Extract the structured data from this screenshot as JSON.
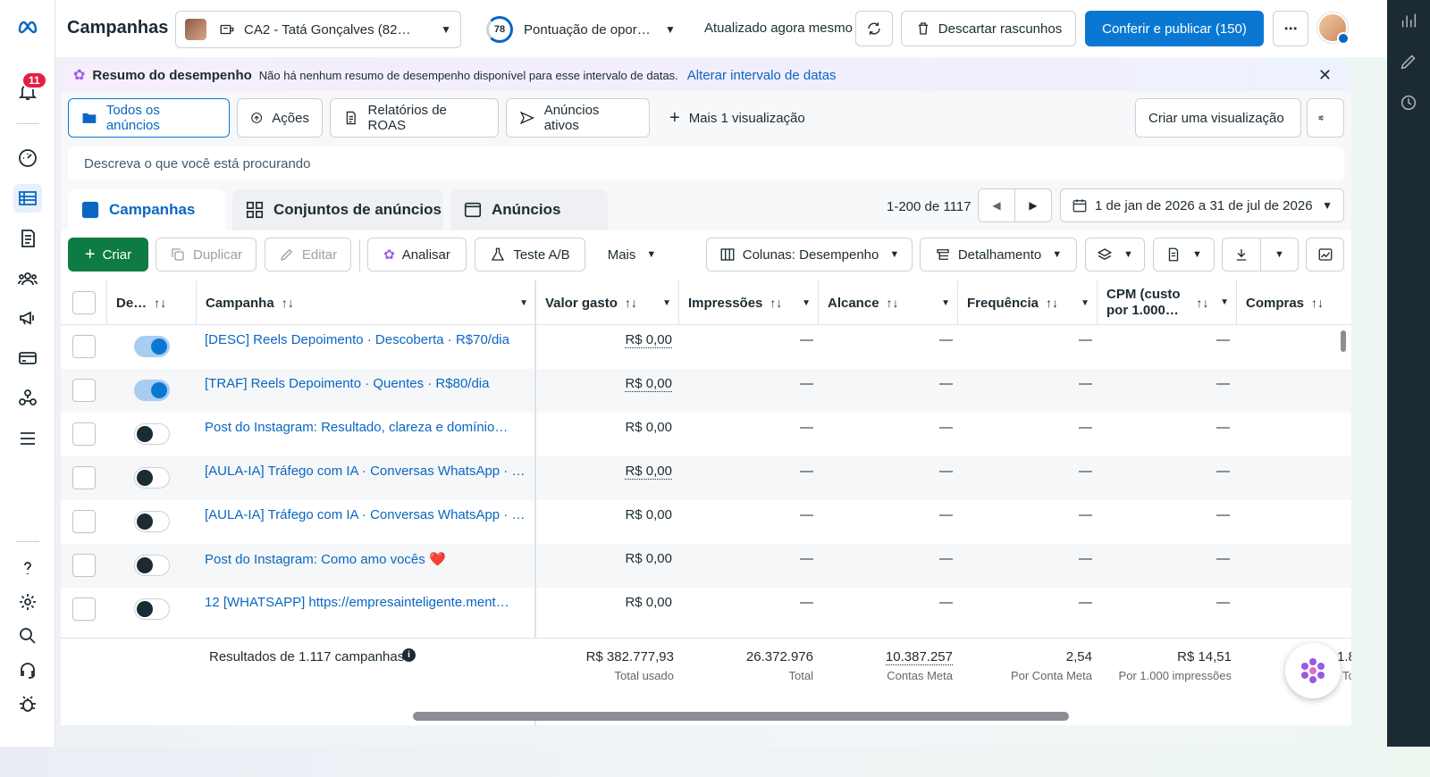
{
  "header": {
    "title": "Campanhas",
    "account": "CA2 - Tatá Gonçalves (82…",
    "score_value": "78",
    "score_label": "Pontuação de oportunidade",
    "updated": "Atualizado agora mesmo",
    "discard_label": "Descartar rascunhos",
    "publish_label": "Conferir e publicar (150)"
  },
  "leftnav": {
    "notification_count": "11"
  },
  "banner": {
    "title": "Resumo do desempenho",
    "desc": "Não há nenhum resumo de desempenho disponível para esse intervalo de datas.",
    "link": "Alterar intervalo de datas"
  },
  "views": {
    "all_ads": "Todos os anúncios",
    "actions": "Ações",
    "roas": "Relatórios de ROAS",
    "active": "Anúncios ativos",
    "more": "Mais 1 visualização",
    "create": "Criar uma visualização"
  },
  "search": {
    "placeholder": "Descreva o que você está procurando"
  },
  "tabs": {
    "campaigns": "Campanhas",
    "adsets": "Conjuntos de anúncios",
    "ads": "Anúncios"
  },
  "pager": {
    "range": "1-200 de 1117"
  },
  "daterange": "1 de jan de 2026 a 31 de jul de 2026",
  "toolbar": {
    "create": "Criar",
    "duplicate": "Duplicar",
    "edit": "Editar",
    "analyze": "Analisar",
    "abtest": "Teste A/B",
    "more": "Mais",
    "columns": "Colunas: Desempenho",
    "breakdown": "Detalhamento"
  },
  "table": {
    "headers": {
      "delivery": "De…",
      "campaign": "Campanha",
      "spent": "Valor gasto",
      "impressions": "Impressões",
      "reach": "Alcance",
      "frequency": "Frequência",
      "cpm1": "CPM (custo",
      "cpm2": "por 1.000…",
      "purchases": "Compras"
    },
    "rows": [
      {
        "name": "[DESC] Reels Depoimento · Descoberta · R$70/dia",
        "on": true,
        "spent": "R$ 0,00",
        "dotted": true
      },
      {
        "name": "[TRAF] Reels Depoimento · Quentes · R$80/dia",
        "on": true,
        "spent": "R$ 0,00",
        "dotted": true
      },
      {
        "name": "Post do Instagram: Resultado, clareza e domínio…",
        "on": false,
        "spent": "R$ 0,00",
        "dotted": false
      },
      {
        "name": "[AULA-IA] Tráfego com IA · Conversas WhatsApp · …",
        "on": false,
        "spent": "R$ 0,00",
        "dotted": true
      },
      {
        "name": "[AULA-IA] Tráfego com IA · Conversas WhatsApp · …",
        "on": false,
        "spent": "R$ 0,00",
        "dotted": false
      },
      {
        "name": "Post do Instagram: Como amo vocês ❤️",
        "on": false,
        "spent": "R$ 0,00",
        "dotted": false
      },
      {
        "name": "12 [WHATSAPP] https://empresainteligente.ment…",
        "on": false,
        "spent": "R$ 0,00",
        "dotted": false
      }
    ],
    "empty": "—",
    "totals": {
      "label": "Resultados de 1.117 campanhas",
      "spent": "R$ 382.777,93",
      "spent_sub": "Total usado",
      "impressions": "26.372.976",
      "impressions_sub": "Total",
      "reach": "10.387.257",
      "reach_sub": "Contas Meta",
      "frequency": "2,54",
      "frequency_sub": "Por Conta Meta",
      "cpm": "R$ 14,51",
      "cpm_sub": "Por 1.000 impressões",
      "purchases": "1.8",
      "purchases_sub": "To"
    }
  },
  "colors": {
    "primary": "#0a78d2",
    "create": "#0e7c42",
    "rail": "#1c2b33"
  }
}
